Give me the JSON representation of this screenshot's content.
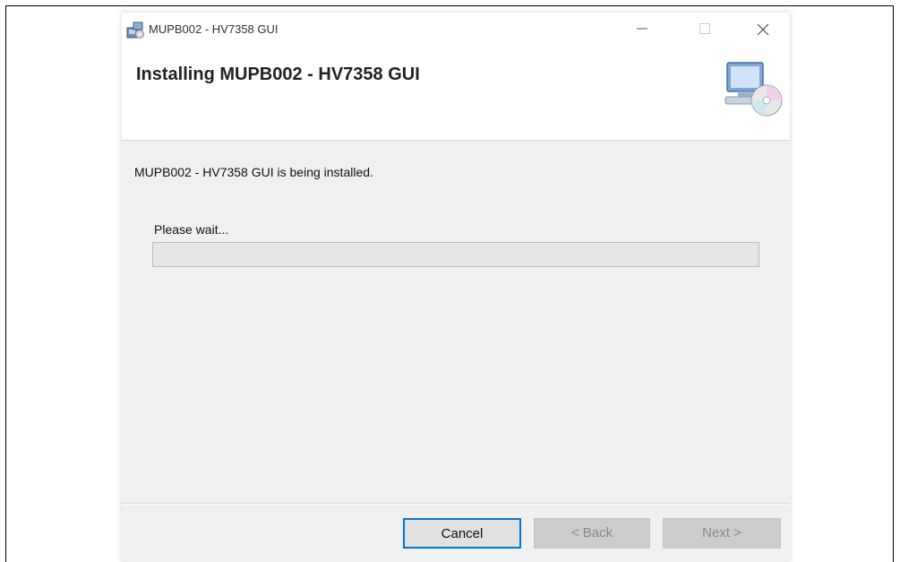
{
  "window": {
    "title": "MUPB002 - HV7358 GUI"
  },
  "header": {
    "title": "Installing MUPB002 - HV7358 GUI",
    "icon": "computer-cd-setup-icon"
  },
  "main": {
    "status_message": "MUPB002 - HV7358 GUI is being installed.",
    "wait_label": "Please wait...",
    "progress_percent": 0
  },
  "footer": {
    "cancel_label": "Cancel",
    "back_label": "< Back",
    "next_label": "Next >"
  },
  "colors": {
    "accent": "#0078d7",
    "progress_fill": "#06b025"
  }
}
